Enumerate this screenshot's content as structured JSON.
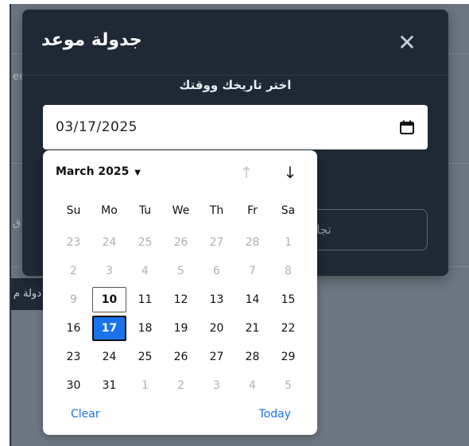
{
  "background": {
    "fragment_left_1": "ee",
    "fragment_left_2": "ق",
    "dark_band_text": "دولة م"
  },
  "modal": {
    "title": "جدولة موعد",
    "close_glyph": "✕",
    "field_label": "اختر تاريخك ووقتك",
    "date_value": "03/17/2025",
    "ignore_label": "تجاهل"
  },
  "calendar": {
    "month_label": "March 2025",
    "nav_up": "↑",
    "nav_down": "↓",
    "weekdays": [
      "Su",
      "Mo",
      "Tu",
      "We",
      "Th",
      "Fr",
      "Sa"
    ],
    "weeks": [
      [
        "23",
        "24",
        "25",
        "26",
        "27",
        "28",
        "1"
      ],
      [
        "2",
        "3",
        "4",
        "5",
        "6",
        "7",
        "8"
      ],
      [
        "9",
        "10",
        "11",
        "12",
        "13",
        "14",
        "15"
      ],
      [
        "16",
        "17",
        "18",
        "19",
        "20",
        "21",
        "22"
      ],
      [
        "23",
        "24",
        "25",
        "26",
        "27",
        "28",
        "29"
      ],
      [
        "30",
        "31",
        "1",
        "2",
        "3",
        "4",
        "5"
      ]
    ],
    "clear_label": "Clear",
    "today_label": "Today"
  },
  "colors": {
    "accent": "#1a73e8",
    "modal_bg": "#1e2935",
    "overlay_bg": "#6c7580"
  },
  "icons": {
    "close": "close-icon",
    "calendar": "calendar-icon",
    "caret": "caret-down-icon"
  }
}
